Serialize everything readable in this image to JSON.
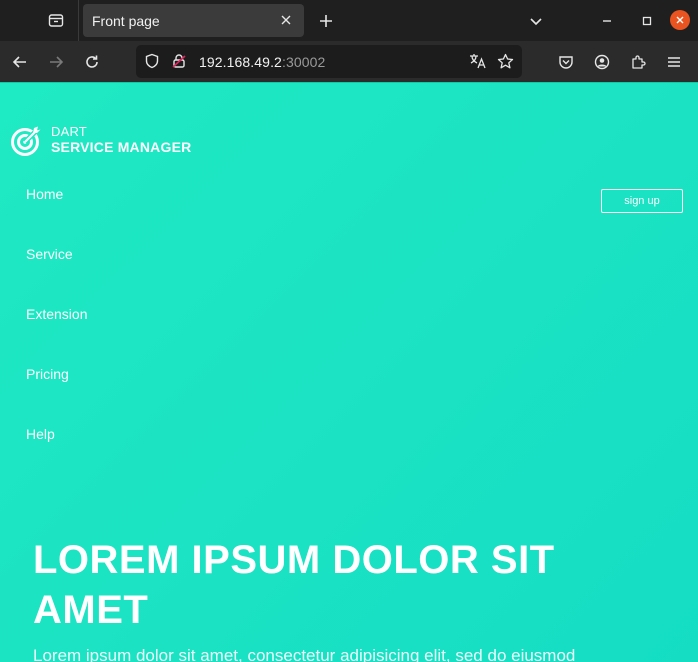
{
  "browser": {
    "tab_title": "Front page",
    "url_host": "192.168.49.2",
    "url_port": ":30002"
  },
  "site": {
    "logo_line1": "DART",
    "logo_line2": "SERVICE MANAGER",
    "menu": [
      {
        "label": "Home"
      },
      {
        "label": "Service"
      },
      {
        "label": "Extension"
      },
      {
        "label": "Pricing"
      },
      {
        "label": "Help"
      }
    ],
    "signup_label": "sign up",
    "hero_title": "LOREM IPSUM DOLOR SIT AMET",
    "hero_subtitle": "Lorem ipsum dolor sit amet, consectetur adipisicing elit, sed do eiusmod"
  },
  "colors": {
    "page_background": "#1ee8c2",
    "window_close": "#e95420"
  }
}
